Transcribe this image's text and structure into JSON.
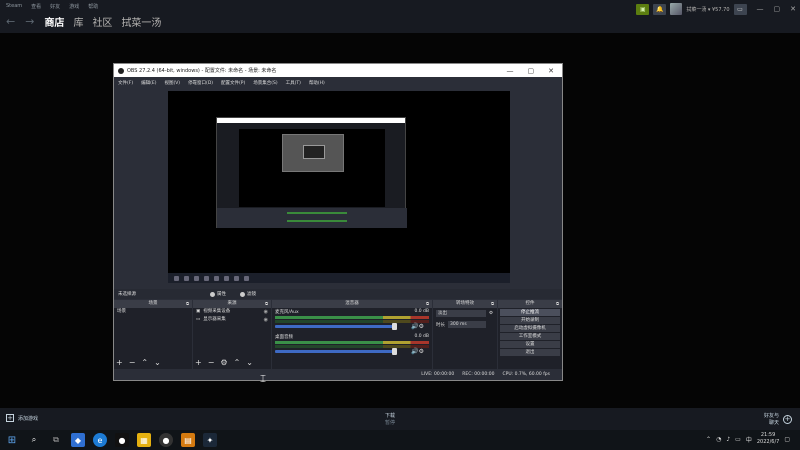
{
  "steam": {
    "menu": [
      "Steam",
      "查看",
      "好友",
      "游戏",
      "帮助"
    ],
    "nav": [
      "商店",
      "库",
      "社区",
      "拭菜一汤"
    ],
    "account": "拭菜一汤 ▾ ¥57.70",
    "window_controls": [
      "—",
      "▢",
      "✕"
    ],
    "add_game": "添加游戏",
    "downloads_title": "下载",
    "downloads_sub": "暂停",
    "friends": "好友与\n聊天"
  },
  "obs": {
    "title": "OBS 27.2.4 (64-bit, windows) - 配置文件: 未命名 - 场景: 未命名",
    "window_controls": [
      "—",
      "▢",
      "✕"
    ],
    "menu": [
      "文件(F)",
      "编辑(E)",
      "视图(V)",
      "停靠窗口(D)",
      "配置文件(P)",
      "场景集合(S)",
      "工具(T)",
      "帮助(H)"
    ],
    "scene_label": "未选择源",
    "scene_btn_props": "属性",
    "scene_btn_filters": "滤镜",
    "docks": {
      "scenes": {
        "title": "场景",
        "items": [
          "场景"
        ]
      },
      "sources": {
        "title": "来源",
        "items": [
          "视频采集设备",
          "显示器采集"
        ]
      },
      "mixer": {
        "title": "混音器",
        "tracks": [
          {
            "name": "麦克风/Aux",
            "db": "0.0 dB"
          },
          {
            "name": "桌面音频",
            "db": "0.0 dB"
          }
        ]
      },
      "transitions": {
        "title": "转场特效",
        "type": "淡出",
        "duration_label": "时长",
        "duration": "300 ms"
      },
      "controls": {
        "title": "控件",
        "buttons": [
          "停止推流",
          "开始录制",
          "启动虚拟摄像机",
          "工作室模式",
          "设置",
          "退出"
        ]
      }
    },
    "status": {
      "live": "LIVE: 00:00:00",
      "rec": "REC: 00:00:00",
      "cpu": "CPU: 0.7%, 60.00 fps"
    }
  },
  "taskbar": {
    "time": "21:59",
    "date": "2022/6/7"
  }
}
